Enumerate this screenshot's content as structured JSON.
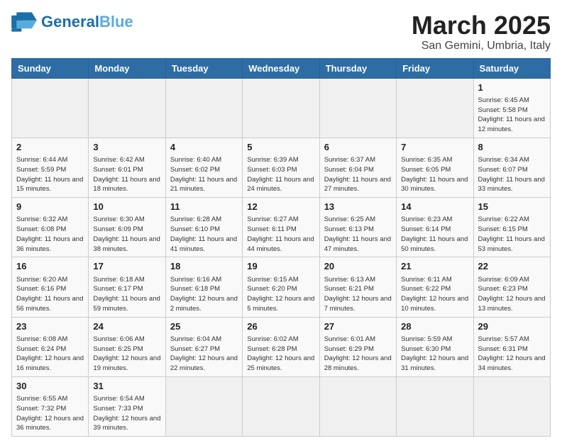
{
  "header": {
    "logo_general": "General",
    "logo_blue": "Blue",
    "month": "March 2025",
    "location": "San Gemini, Umbria, Italy"
  },
  "weekdays": [
    "Sunday",
    "Monday",
    "Tuesday",
    "Wednesday",
    "Thursday",
    "Friday",
    "Saturday"
  ],
  "days": [
    {
      "num": "",
      "info": ""
    },
    {
      "num": "",
      "info": ""
    },
    {
      "num": "",
      "info": ""
    },
    {
      "num": "",
      "info": ""
    },
    {
      "num": "",
      "info": ""
    },
    {
      "num": "",
      "info": ""
    },
    {
      "num": "1",
      "info": "Sunrise: 6:45 AM\nSunset: 5:58 PM\nDaylight: 11 hours\nand 12 minutes."
    },
    {
      "num": "2",
      "info": "Sunrise: 6:44 AM\nSunset: 5:59 PM\nDaylight: 11 hours\nand 15 minutes."
    },
    {
      "num": "3",
      "info": "Sunrise: 6:42 AM\nSunset: 6:01 PM\nDaylight: 11 hours\nand 18 minutes."
    },
    {
      "num": "4",
      "info": "Sunrise: 6:40 AM\nSunset: 6:02 PM\nDaylight: 11 hours\nand 21 minutes."
    },
    {
      "num": "5",
      "info": "Sunrise: 6:39 AM\nSunset: 6:03 PM\nDaylight: 11 hours\nand 24 minutes."
    },
    {
      "num": "6",
      "info": "Sunrise: 6:37 AM\nSunset: 6:04 PM\nDaylight: 11 hours\nand 27 minutes."
    },
    {
      "num": "7",
      "info": "Sunrise: 6:35 AM\nSunset: 6:05 PM\nDaylight: 11 hours\nand 30 minutes."
    },
    {
      "num": "8",
      "info": "Sunrise: 6:34 AM\nSunset: 6:07 PM\nDaylight: 11 hours\nand 33 minutes."
    },
    {
      "num": "9",
      "info": "Sunrise: 6:32 AM\nSunset: 6:08 PM\nDaylight: 11 hours\nand 36 minutes."
    },
    {
      "num": "10",
      "info": "Sunrise: 6:30 AM\nSunset: 6:09 PM\nDaylight: 11 hours\nand 38 minutes."
    },
    {
      "num": "11",
      "info": "Sunrise: 6:28 AM\nSunset: 6:10 PM\nDaylight: 11 hours\nand 41 minutes."
    },
    {
      "num": "12",
      "info": "Sunrise: 6:27 AM\nSunset: 6:11 PM\nDaylight: 11 hours\nand 44 minutes."
    },
    {
      "num": "13",
      "info": "Sunrise: 6:25 AM\nSunset: 6:13 PM\nDaylight: 11 hours\nand 47 minutes."
    },
    {
      "num": "14",
      "info": "Sunrise: 6:23 AM\nSunset: 6:14 PM\nDaylight: 11 hours\nand 50 minutes."
    },
    {
      "num": "15",
      "info": "Sunrise: 6:22 AM\nSunset: 6:15 PM\nDaylight: 11 hours\nand 53 minutes."
    },
    {
      "num": "16",
      "info": "Sunrise: 6:20 AM\nSunset: 6:16 PM\nDaylight: 11 hours\nand 56 minutes."
    },
    {
      "num": "17",
      "info": "Sunrise: 6:18 AM\nSunset: 6:17 PM\nDaylight: 11 hours\nand 59 minutes."
    },
    {
      "num": "18",
      "info": "Sunrise: 6:16 AM\nSunset: 6:18 PM\nDaylight: 12 hours\nand 2 minutes."
    },
    {
      "num": "19",
      "info": "Sunrise: 6:15 AM\nSunset: 6:20 PM\nDaylight: 12 hours\nand 5 minutes."
    },
    {
      "num": "20",
      "info": "Sunrise: 6:13 AM\nSunset: 6:21 PM\nDaylight: 12 hours\nand 7 minutes."
    },
    {
      "num": "21",
      "info": "Sunrise: 6:11 AM\nSunset: 6:22 PM\nDaylight: 12 hours\nand 10 minutes."
    },
    {
      "num": "22",
      "info": "Sunrise: 6:09 AM\nSunset: 6:23 PM\nDaylight: 12 hours\nand 13 minutes."
    },
    {
      "num": "23",
      "info": "Sunrise: 6:08 AM\nSunset: 6:24 PM\nDaylight: 12 hours\nand 16 minutes."
    },
    {
      "num": "24",
      "info": "Sunrise: 6:06 AM\nSunset: 6:25 PM\nDaylight: 12 hours\nand 19 minutes."
    },
    {
      "num": "25",
      "info": "Sunrise: 6:04 AM\nSunset: 6:27 PM\nDaylight: 12 hours\nand 22 minutes."
    },
    {
      "num": "26",
      "info": "Sunrise: 6:02 AM\nSunset: 6:28 PM\nDaylight: 12 hours\nand 25 minutes."
    },
    {
      "num": "27",
      "info": "Sunrise: 6:01 AM\nSunset: 6:29 PM\nDaylight: 12 hours\nand 28 minutes."
    },
    {
      "num": "28",
      "info": "Sunrise: 5:59 AM\nSunset: 6:30 PM\nDaylight: 12 hours\nand 31 minutes."
    },
    {
      "num": "29",
      "info": "Sunrise: 5:57 AM\nSunset: 6:31 PM\nDaylight: 12 hours\nand 34 minutes."
    },
    {
      "num": "30",
      "info": "Sunrise: 6:55 AM\nSunset: 7:32 PM\nDaylight: 12 hours\nand 36 minutes."
    },
    {
      "num": "31",
      "info": "Sunrise: 6:54 AM\nSunset: 7:33 PM\nDaylight: 12 hours\nand 39 minutes."
    },
    {
      "num": "",
      "info": ""
    },
    {
      "num": "",
      "info": ""
    },
    {
      "num": "",
      "info": ""
    },
    {
      "num": "",
      "info": ""
    },
    {
      "num": "",
      "info": ""
    }
  ]
}
